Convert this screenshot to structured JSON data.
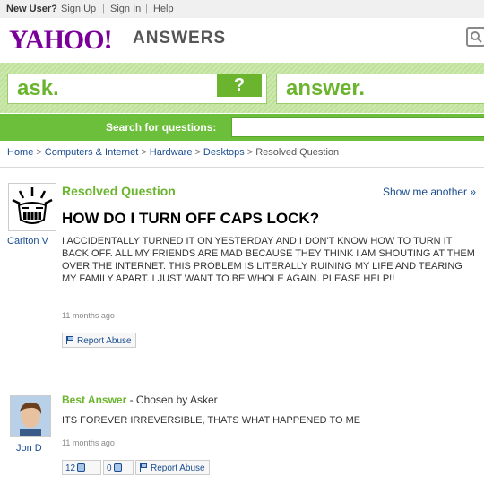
{
  "topbar": {
    "new_user": "New User?",
    "sign_up": "Sign Up",
    "sign_in": "Sign In",
    "help": "Help"
  },
  "header": {
    "logo": "YAHOO!",
    "product": "ANSWERS"
  },
  "ask_band": {
    "ask_label": "ask.",
    "question_mark": "?",
    "answer_label": "answer."
  },
  "search": {
    "label": "Search for questions:",
    "value": ""
  },
  "breadcrumb": {
    "items": [
      "Home",
      "Computers & Internet",
      "Hardware",
      "Desktops",
      "Resolved Question"
    ]
  },
  "question": {
    "status": "Resolved Question",
    "show_another": "Show me another »",
    "asker": "Carlton V",
    "title": "HOW DO I TURN OFF CAPS LOCK?",
    "body": "I ACCIDENTALLY TURNED IT ON YESTERDAY AND I DON'T KNOW HOW TO TURN IT BACK OFF. ALL MY FRIENDS ARE MAD BECAUSE THEY THINK I AM SHOUTING AT THEM OVER THE INTERNET. THIS PROBLEM IS LITERALLY RUINING MY LIFE AND TEARING MY FAMILY APART. I JUST WANT TO BE WHOLE AGAIN. PLEASE HELP!!",
    "time": "11 months ago",
    "report": "Report Abuse"
  },
  "best_answer": {
    "label": "Best Answer",
    "chosen": " - Chosen by Asker",
    "answerer": "Jon D",
    "body": "ITS FOREVER IRREVERSIBLE, THATS WHAT HAPPENED TO ME",
    "time": "11 months ago",
    "thumbs_up": "12",
    "thumbs_down": "0",
    "report": "Report Abuse"
  },
  "colors": {
    "yahoo_purple": "#7b0099",
    "answers_green": "#6bb52e",
    "link_blue": "#1a4d8f"
  }
}
